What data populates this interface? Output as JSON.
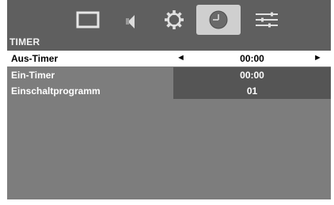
{
  "tabs": [
    {
      "icon": "screen-icon",
      "active": false
    },
    {
      "icon": "speaker-icon",
      "active": false
    },
    {
      "icon": "gear-icon",
      "active": false
    },
    {
      "icon": "clock-icon",
      "active": true
    },
    {
      "icon": "sliders-icon",
      "active": false
    }
  ],
  "section_title": "TIMER",
  "rows": [
    {
      "label": "Aus-Timer",
      "value": "00:00",
      "selected": true
    },
    {
      "label": "Ein-Timer",
      "value": "00:00",
      "selected": false
    },
    {
      "label": "Einschaltprogramm",
      "value": "01",
      "selected": false
    }
  ],
  "arrows": {
    "left": "◄",
    "right": "►"
  },
  "colors": {
    "background": "#5f5f5f",
    "panel": "#7d7d7d",
    "value_cell": "#555555",
    "highlight": "#ffffff",
    "active_tab": "#cfcfcf"
  }
}
